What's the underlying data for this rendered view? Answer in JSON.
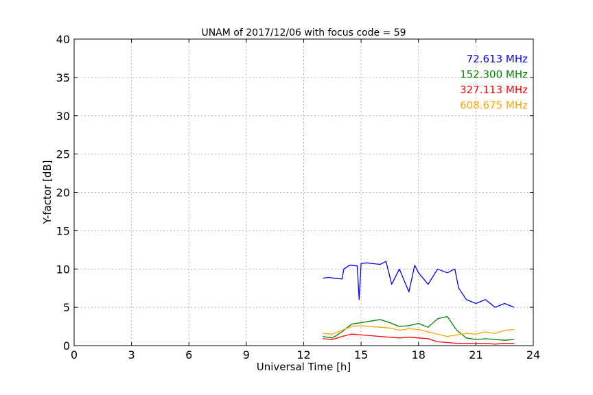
{
  "chart_data": {
    "type": "line",
    "title": "UNAM of 2017/12/06 with focus code = 59",
    "xlabel": "Universal Time [h]",
    "ylabel": "Y-factor [dB]",
    "xlim": [
      0,
      24
    ],
    "ylim": [
      0,
      40
    ],
    "xticks": [
      0,
      3,
      6,
      9,
      12,
      15,
      18,
      21,
      24
    ],
    "yticks": [
      0,
      5,
      10,
      15,
      20,
      25,
      30,
      35,
      40
    ],
    "grid": true,
    "legend_position": "top-right",
    "series": [
      {
        "name": "72.613 MHz",
        "color": "#0000ff",
        "x": [
          13.0,
          13.3,
          13.6,
          14.0,
          14.1,
          14.4,
          14.8,
          14.9,
          15.0,
          15.3,
          15.6,
          16.0,
          16.3,
          16.6,
          17.0,
          17.5,
          17.8,
          18.0,
          18.5,
          19.0,
          19.5,
          19.9,
          20.1,
          20.5,
          21.0,
          21.5,
          22.0,
          22.5,
          23.0
        ],
        "y": [
          8.8,
          8.9,
          8.8,
          8.7,
          10.0,
          10.5,
          10.4,
          6.0,
          10.7,
          10.8,
          10.7,
          10.6,
          11.0,
          8.0,
          10.0,
          7.0,
          10.5,
          9.5,
          8.0,
          10.0,
          9.5,
          10.0,
          7.5,
          6.0,
          5.5,
          6.0,
          5.0,
          5.5,
          5.0
        ]
      },
      {
        "name": "152.300 MHz",
        "color": "#008000",
        "x": [
          13.0,
          13.5,
          14.0,
          14.5,
          15.0,
          15.5,
          16.0,
          16.5,
          17.0,
          17.5,
          18.0,
          18.5,
          19.0,
          19.5,
          20.0,
          20.5,
          21.0,
          21.5,
          22.0,
          22.5,
          23.0
        ],
        "y": [
          1.2,
          1.0,
          1.8,
          2.8,
          3.0,
          3.2,
          3.4,
          3.0,
          2.5,
          2.6,
          2.9,
          2.4,
          3.5,
          3.8,
          2.0,
          1.0,
          0.8,
          0.9,
          0.8,
          0.7,
          0.8
        ]
      },
      {
        "name": "327.113 MHz",
        "color": "#ff0000",
        "x": [
          13.0,
          13.5,
          14.0,
          14.5,
          15.0,
          15.5,
          16.0,
          16.5,
          17.0,
          17.5,
          18.0,
          18.5,
          19.0,
          19.5,
          20.0,
          20.5,
          21.0,
          21.5,
          22.0,
          22.5,
          23.0
        ],
        "y": [
          0.9,
          0.8,
          1.2,
          1.5,
          1.4,
          1.3,
          1.2,
          1.1,
          1.0,
          1.1,
          1.0,
          0.9,
          0.5,
          0.4,
          0.3,
          0.3,
          0.3,
          0.3,
          0.2,
          0.3,
          0.3
        ]
      },
      {
        "name": "608.675 MHz",
        "color": "#ffa500",
        "x": [
          13.0,
          13.5,
          14.0,
          14.5,
          15.0,
          15.5,
          16.0,
          16.5,
          17.0,
          17.5,
          18.0,
          18.5,
          19.0,
          19.5,
          20.0,
          20.5,
          21.0,
          21.5,
          22.0,
          22.5,
          23.0
        ],
        "y": [
          1.6,
          1.5,
          2.0,
          2.5,
          2.6,
          2.5,
          2.4,
          2.3,
          2.0,
          2.2,
          2.1,
          1.8,
          1.5,
          1.2,
          1.4,
          1.6,
          1.5,
          1.8,
          1.6,
          2.0,
          2.1
        ]
      }
    ]
  }
}
